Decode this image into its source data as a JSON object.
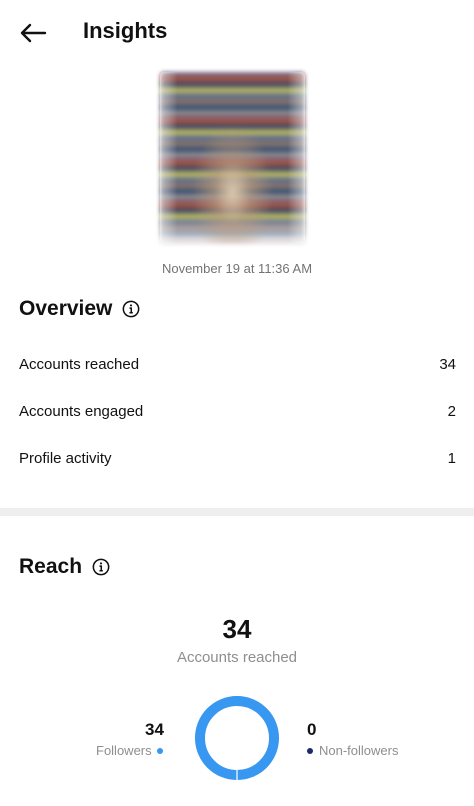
{
  "header": {
    "title": "Insights",
    "back_icon": "arrow-left-icon"
  },
  "post": {
    "timestamp": "November 19 at 11:36 AM"
  },
  "overview": {
    "title": "Overview",
    "info_icon": "info-icon",
    "rows": [
      {
        "label": "Accounts reached",
        "value": "34"
      },
      {
        "label": "Accounts engaged",
        "value": "2"
      },
      {
        "label": "Profile activity",
        "value": "1"
      }
    ]
  },
  "reach": {
    "title": "Reach",
    "info_icon": "info-icon",
    "total": "34",
    "total_label": "Accounts reached",
    "followers": {
      "value": "34",
      "label": "Followers",
      "color": "#3897f0",
      "count": 34
    },
    "non_followers": {
      "value": "0",
      "label": "Non-followers",
      "color": "#1c2a6b",
      "count": 0
    }
  }
}
